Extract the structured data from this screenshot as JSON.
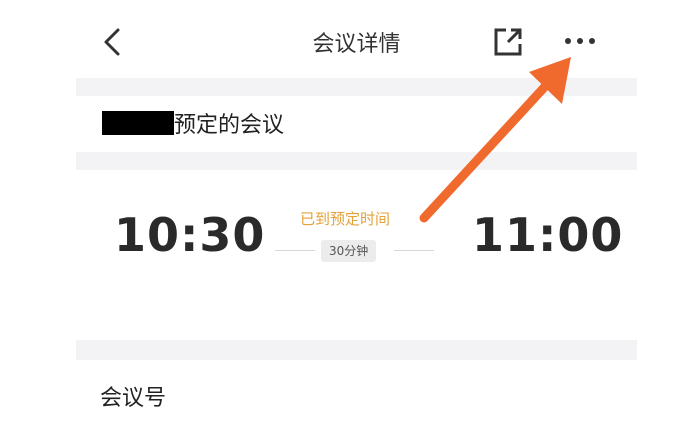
{
  "header": {
    "title": "会议详情"
  },
  "organizer": {
    "suffix": "预定的会议"
  },
  "schedule": {
    "start_time": "10:30",
    "end_time": "11:00",
    "status": "已到预定时间",
    "duration": "30分钟"
  },
  "details": {
    "meeting_id_label": "会议号"
  },
  "colors": {
    "status_text": "#e3a23a",
    "annotation_arrow": "#f0692d"
  },
  "icons": {
    "back": "chevron-left-icon",
    "share": "external-share-icon",
    "more": "more-dots-icon"
  }
}
